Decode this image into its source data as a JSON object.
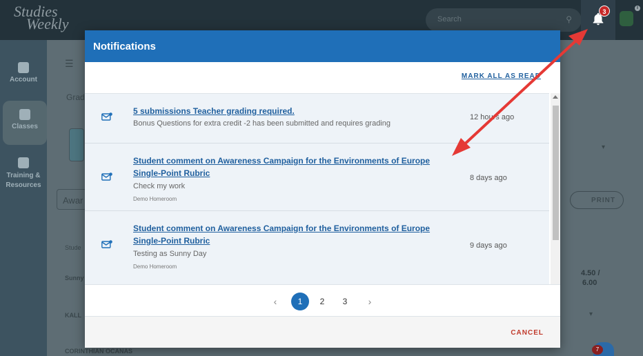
{
  "app": {
    "logo_line1": "Studies",
    "logo_line2": "Weekly",
    "search_placeholder": "Search",
    "notification_count": "3"
  },
  "sidebar": {
    "items": [
      {
        "label": "Account",
        "icon": "home-icon"
      },
      {
        "label": "Classes",
        "icon": "book-icon"
      },
      {
        "label": "Training & Resources",
        "icon": "library-icon"
      }
    ]
  },
  "background": {
    "crumb": "Grad",
    "field_label": "Awar",
    "col_header": "Stude",
    "row1_name": "Sunny",
    "row1_score_line1": "4.50 /",
    "row1_score_line2": "6.00",
    "row2_name": "KALL",
    "row3_name": "CORINTHIAN OCANAS",
    "print_label": "PRINT",
    "bottom_badge": "7"
  },
  "modal": {
    "title": "Notifications",
    "mark_all_label": "MARK ALL AS READ",
    "cancel_label": "CANCEL",
    "notifications": [
      {
        "title": "5 submissions Teacher grading required.",
        "desc": "Bonus Questions for extra credit -2 has been submitted and requires grading",
        "sub": "",
        "time": "12 hours ago"
      },
      {
        "title_line1": "Student comment on Awareness Campaign for the Environments of Europe",
        "title_line2": "Single-Point Rubric",
        "desc": "Check my work",
        "sub": "Demo Homeroom",
        "time": "8 days ago"
      },
      {
        "title_line1": "Student comment on Awareness Campaign for the Environments of Europe",
        "title_line2": "Single-Point Rubric",
        "desc": "Testing as Sunny Day",
        "sub": "Demo Homeroom",
        "time": "9 days ago"
      }
    ],
    "pagination": {
      "prev": "‹",
      "pages": [
        "1",
        "2",
        "3"
      ],
      "next": "›",
      "current": "1"
    }
  },
  "colors": {
    "header_blue": "#1f6fb8",
    "link_blue": "#1f5f9e",
    "cancel_red": "#c0392b",
    "badge_red": "#c62828",
    "annotation_red": "#e53935"
  }
}
